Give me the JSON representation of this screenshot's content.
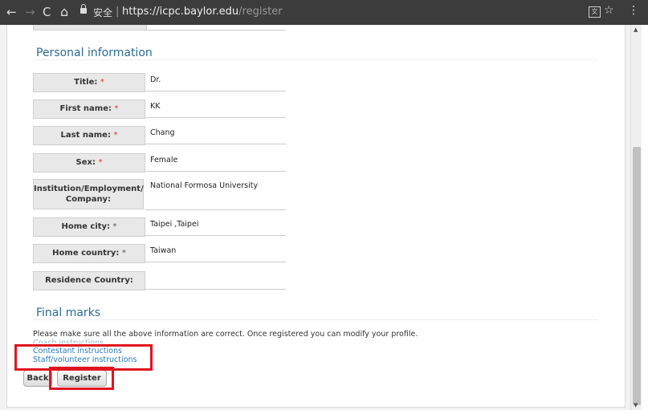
{
  "browser": {
    "back_icon": "←",
    "forward_icon": "→",
    "reload_icon": "C",
    "home_icon": "⌂",
    "secure_label": "安全",
    "separator": "|",
    "url_host": "https://icpc.baylor.edu",
    "url_path": "/register",
    "translate_icon": "文",
    "star_icon": "☆",
    "menu_icon": "⋮"
  },
  "personal": {
    "title": "Personal information",
    "fields": [
      {
        "label": "Title:",
        "required": "*",
        "value": "Dr."
      },
      {
        "label": "First name:",
        "required": "*",
        "value": "KK"
      },
      {
        "label": "Last name:",
        "required": "*",
        "value": "Chang"
      },
      {
        "label": "Sex:",
        "required": "*",
        "value": "Female"
      },
      {
        "label": "Institution/Employment/ Company:",
        "required": "",
        "value": "National Formosa University"
      },
      {
        "label": "Home city:",
        "required": "*",
        "value": "Taipei ,Taipei"
      },
      {
        "label": "Home country:",
        "required": "*",
        "value": "Taiwan"
      },
      {
        "label": "Residence Country:",
        "required": "",
        "value": ""
      }
    ]
  },
  "final": {
    "title": "Final marks",
    "note": "Please make sure all the above information are correct. Once registered you can modify your profile.",
    "links": [
      "Coach instructions",
      "Contestant instructions",
      "Staff/volunteer instructions"
    ],
    "back_label": "Back",
    "register_label": "Register"
  },
  "colors": {
    "accent": "#2b6a93",
    "link": "#2a7ab8",
    "highlight": "#e0141e"
  }
}
